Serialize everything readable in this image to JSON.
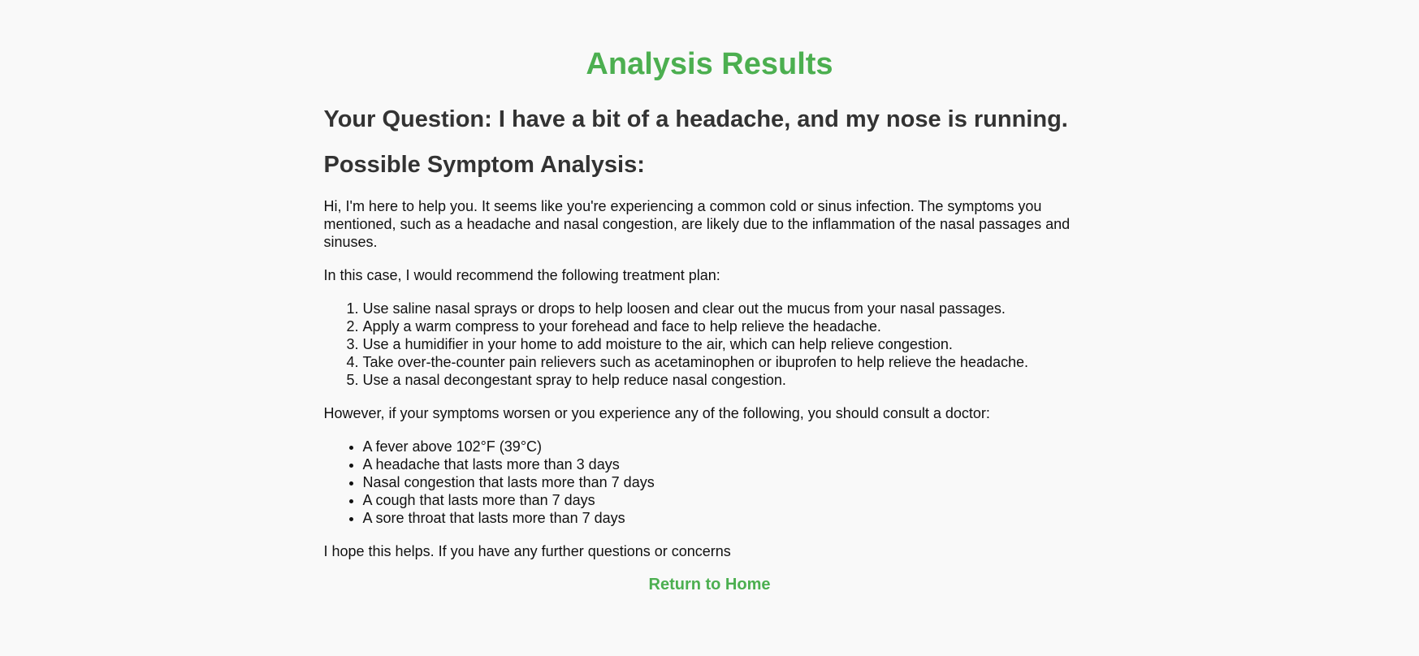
{
  "page": {
    "title": "Analysis Results",
    "question_heading": "Your Question: I have a bit of a headache, and my nose is running.",
    "analysis_heading": "Possible Symptom Analysis:"
  },
  "content": {
    "intro": "Hi, I'm here to help you. It seems like you're experiencing a common cold or sinus infection. The symptoms you mentioned, such as a headache and nasal congestion, are likely due to the inflammation of the nasal passages and sinuses.",
    "treatment_intro": "In this case, I would recommend the following treatment plan:",
    "treatment_steps": [
      "Use saline nasal sprays or drops to help loosen and clear out the mucus from your nasal passages.",
      "Apply a warm compress to your forehead and face to help relieve the headache.",
      "Use a humidifier in your home to add moisture to the air, which can help relieve congestion.",
      "Take over-the-counter pain relievers such as acetaminophen or ibuprofen to help relieve the headache.",
      "Use a nasal decongestant spray to help reduce nasal congestion."
    ],
    "doctor_intro": "However, if your symptoms worsen or you experience any of the following, you should consult a doctor:",
    "warning_signs": [
      "A fever above 102°F (39°C)",
      "A headache that lasts more than 3 days",
      "Nasal congestion that lasts more than 7 days",
      "A cough that lasts more than 7 days",
      "A sore throat that lasts more than 7 days"
    ],
    "closing": "I hope this helps. If you have any further questions or concerns"
  },
  "navigation": {
    "return_label": "Return to Home"
  },
  "colors": {
    "accent": "#4caf50",
    "heading": "#333333",
    "background": "#f9f9f9"
  }
}
